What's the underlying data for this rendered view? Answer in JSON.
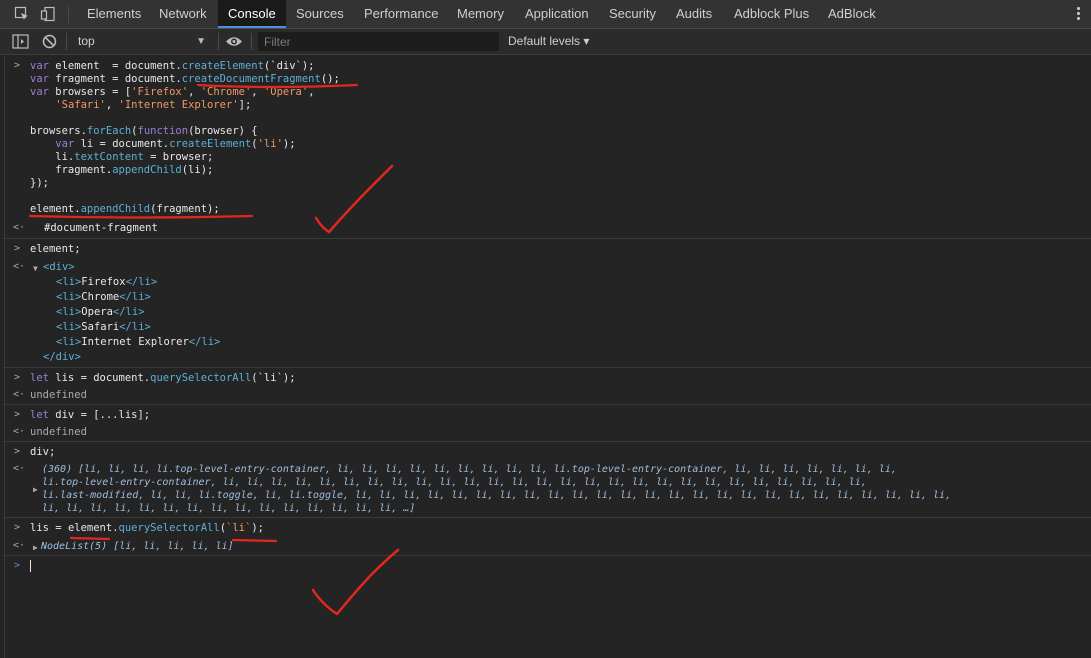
{
  "tabs": [
    "Elements",
    "Network",
    "Console",
    "Sources",
    "Performance",
    "Memory",
    "Application",
    "Security",
    "Audits",
    "Adblock Plus",
    "AdBlock"
  ],
  "active_tab": "Console",
  "toolbar": {
    "context": "top",
    "filter_placeholder": "Filter",
    "levels": "Default levels ▾"
  },
  "colors": {
    "keyword": "#9a7fd5",
    "function": "#5db0d7",
    "string": "#f29766",
    "annotation": "#e0281e"
  },
  "console": {
    "entry1": {
      "l1": [
        "var",
        " element  = document.",
        "createElement",
        "(`div`);"
      ],
      "l2": [
        "var",
        " fragment = document.",
        "createDocumentFragment",
        "();"
      ],
      "l3": [
        "var",
        " browsers = [",
        "'Firefox'",
        ", ",
        "'Chrome'",
        ", ",
        "'Opera'",
        ","
      ],
      "l4": [
        "    ",
        "'Safari'",
        ", ",
        "'Internet Explorer'",
        "];"
      ],
      "l5": [
        "browsers.",
        "forEach",
        "(",
        "function",
        "(browser) {"
      ],
      "l6": [
        "    ",
        "var",
        " li = document.",
        "createElement",
        "(",
        "'li'",
        ");"
      ],
      "l7": [
        "    li.",
        "textContent",
        " = browser;"
      ],
      "l8": [
        "    fragment.",
        "appendChild",
        "(li);"
      ],
      "l9": "});",
      "l10": [
        "element.",
        "appendChild",
        "(fragment);"
      ],
      "result": "#document-fragment"
    },
    "entry2": {
      "input": "element;",
      "div_open": "<div>",
      "items": [
        "Firefox",
        "Chrome",
        "Opera",
        "Safari",
        "Internet Explorer"
      ],
      "li_open": "<li>",
      "li_close": "</li>",
      "div_close": "</div>"
    },
    "entry3": {
      "input": [
        "let",
        " lis = document.",
        "querySelectorAll",
        "(`li`);"
      ],
      "result": "undefined"
    },
    "entry4": {
      "input": [
        "let",
        " div = [...lis];"
      ],
      "result": "undefined"
    },
    "entry5": {
      "input": "div;",
      "r1": "(360) [li, li, li, li.top-level-entry-container, li, li, li, li, li, li, li, li, li, li.top-level-entry-container, li, li, li, li, li, li, li,",
      "r2": "li.top-level-entry-container, li, li, li, li, li, li, li, li, li, li, li, li, li, li, li, li, li, li, li, li, li, li, li, li, li, li, li,",
      "r3": "li.last-modified, li, li, li.toggle, li, li.toggle, li, li, li, li, li, li, li, li, li, li, li, li, li, li, li, li, li, li, li, li, li, li, li, li, li,",
      "r4": "li, li, li, li, li, li, li, li, li, li, li, li, li, li, li, …]"
    },
    "entry6": {
      "input": [
        "lis = ",
        "element",
        ".",
        "querySelectorAll",
        "(",
        "`li`",
        ");"
      ],
      "result": "NodeList(5) [li, li, li, li, li]"
    }
  }
}
